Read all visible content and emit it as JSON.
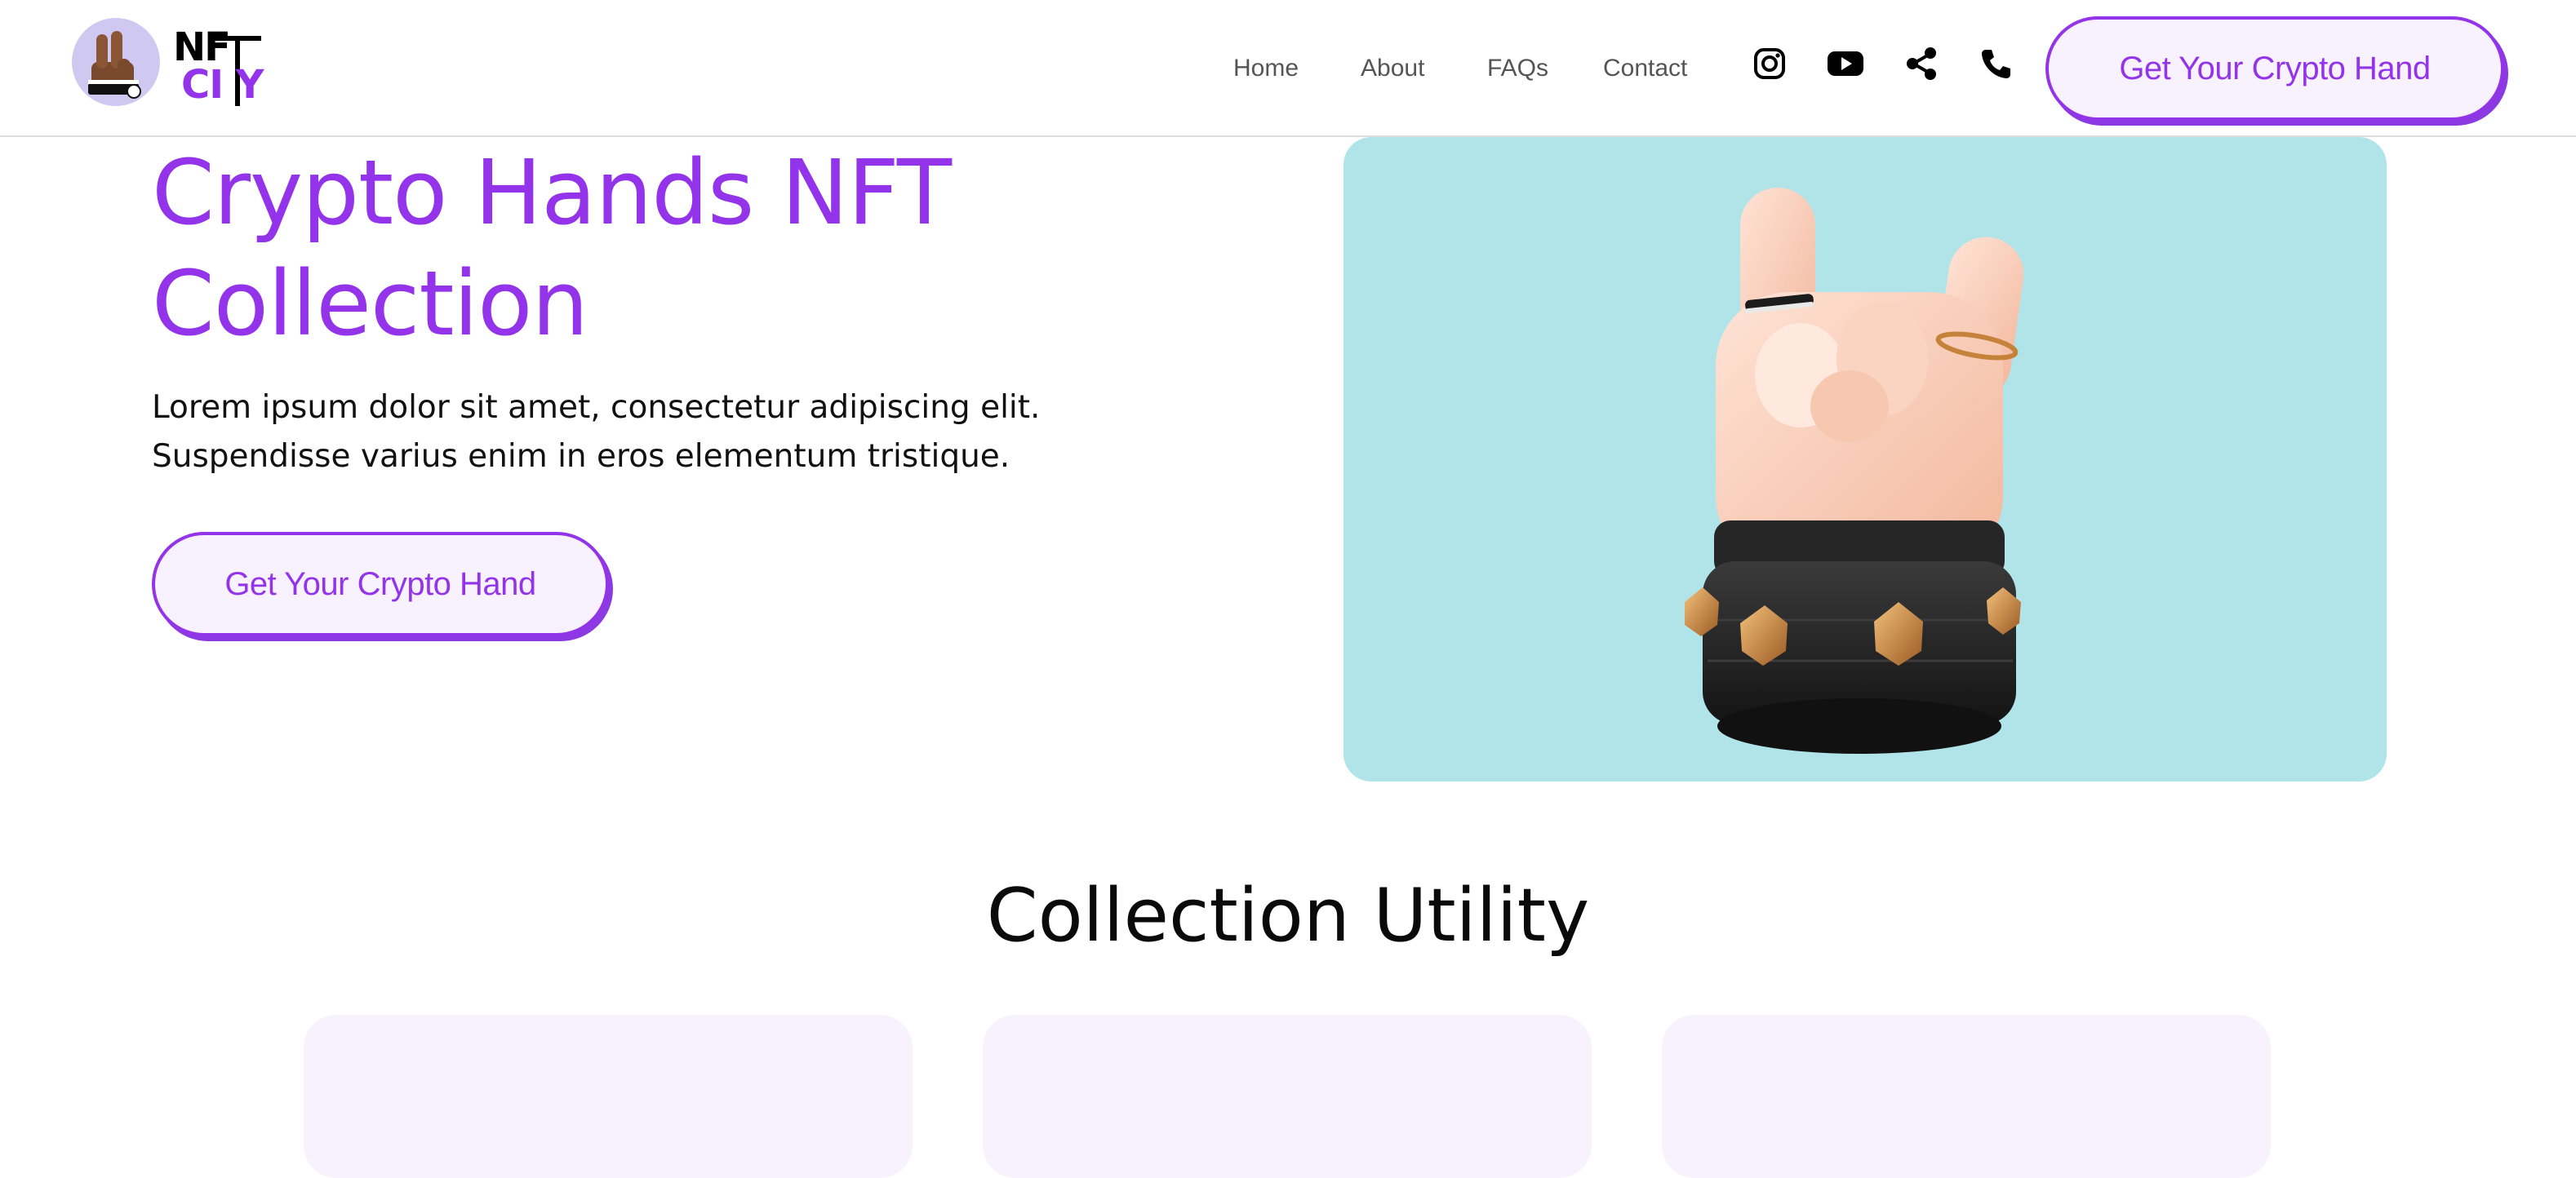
{
  "brand": {
    "logo_nf": "NF",
    "logo_city": "CI Y",
    "accent_color": "#9333ea",
    "logo_badge_color": "#cfc9f2"
  },
  "nav": {
    "links": [
      "Home",
      "About",
      "FAQs",
      "Contact"
    ],
    "social_icons": [
      "instagram-icon",
      "youtube-icon",
      "share-icon",
      "phone-icon"
    ],
    "cta_label": "Get Your Crypto Hand"
  },
  "hero": {
    "title": "Crypto Hands NFT Collection",
    "subtitle_line1": "Lorem ipsum dolor sit amet, consectetur adipiscing elit.",
    "subtitle_line2": "Suspendisse varius enim in eros elementum tristique.",
    "cta_label": "Get Your Crypto Hand",
    "image_bg": "#b1e4e8",
    "image_subject": "rock-hand-with-spiked-bracelet"
  },
  "utility": {
    "title": "Collection Utility",
    "card_count": 3,
    "card_bg": "#f8f2ff"
  }
}
